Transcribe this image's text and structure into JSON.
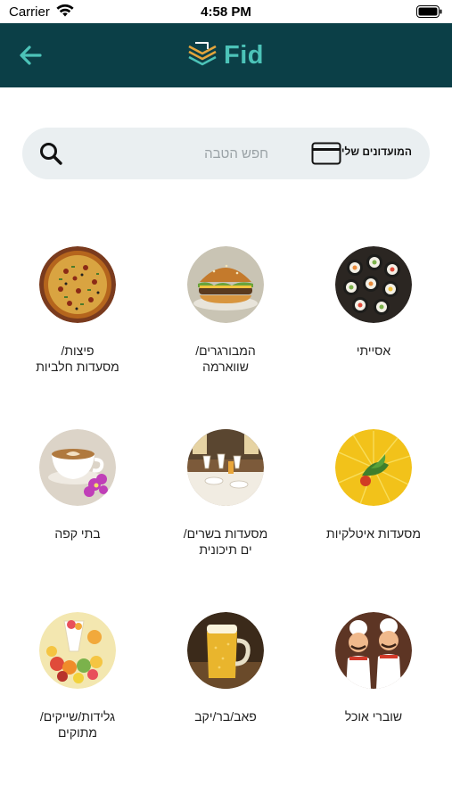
{
  "status_bar": {
    "carrier": "Carrier",
    "time": "4:58 PM"
  },
  "header": {
    "brand_name": "Fid",
    "back_icon": "arrow-left-icon",
    "colors": {
      "background": "#0b3f47",
      "accent": "#4cc3b8"
    }
  },
  "search": {
    "placeholder": "חפש הטבה",
    "clubs_label": "המועדונים שלי"
  },
  "categories": [
    {
      "label": "אסייתי",
      "image": "sushi"
    },
    {
      "label": "המבורגרים/\nשווארמה",
      "image": "burger"
    },
    {
      "label": "פיצות/\nמסעדות חלביות",
      "image": "pizza"
    },
    {
      "label": "מסעדות איטלקיות",
      "image": "pasta"
    },
    {
      "label": "מסעדות בשרים/\nים תיכונית",
      "image": "restaurant-table"
    },
    {
      "label": "בתי קפה",
      "image": "coffee-cup"
    },
    {
      "label": "שוברי אוכל",
      "image": "chef-figurines"
    },
    {
      "label": "פאב/בר/יקב",
      "image": "beer-mug"
    },
    {
      "label": "גלידות/שייקים/\nמתוקים",
      "image": "fruit-dessert"
    }
  ]
}
